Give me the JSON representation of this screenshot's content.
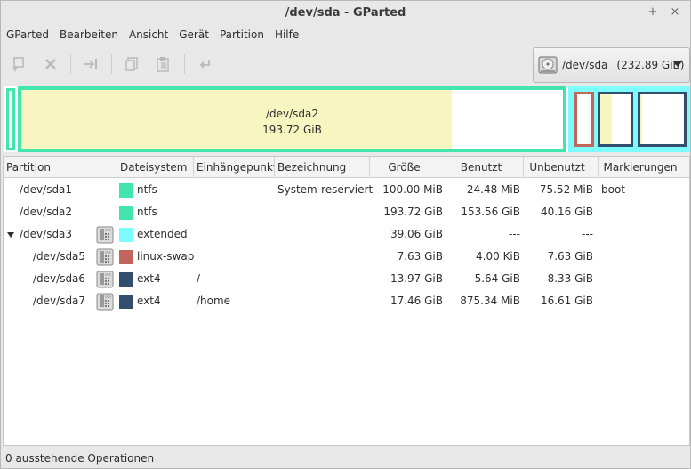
{
  "window": {
    "title": "/dev/sda - GParted",
    "minimize": "–",
    "maximize": "+",
    "close": "×"
  },
  "menu": [
    "GParted",
    "Bearbeiten",
    "Ansicht",
    "Gerät",
    "Partition",
    "Hilfe"
  ],
  "toolbar": {
    "icons": [
      "new-partition-icon",
      "delete-icon",
      "resize-move-icon",
      "copy-icon",
      "paste-icon",
      "undo-icon"
    ]
  },
  "device": {
    "name": "/dev/sda",
    "size": "(232.89 GiB)"
  },
  "diskmap": {
    "selected_label": "/dev/sda2",
    "selected_size": "193.72 GiB",
    "colors": {
      "ntfs": "#42e5ac",
      "extended": "#7dfcfe",
      "linux_swap": "#c1665a",
      "ext4": "#314e6c",
      "used": "#f7f6c0"
    }
  },
  "columns": [
    "Partition",
    "Dateisystem",
    "Einhängepunkt",
    "Bezeichnung",
    "Größe",
    "Benutzt",
    "Unbenutzt",
    "Markierungen"
  ],
  "rows": [
    {
      "partition": "/dev/sda1",
      "filesystem": "ntfs",
      "color": "#42e5ac",
      "mount": "",
      "label": "System-reserviert",
      "size": "100.00 MiB",
      "used": "24.48 MiB",
      "unused": "75.52 MiB",
      "flags": "boot",
      "locked": false,
      "level": 0
    },
    {
      "partition": "/dev/sda2",
      "filesystem": "ntfs",
      "color": "#42e5ac",
      "mount": "",
      "label": "",
      "size": "193.72 GiB",
      "used": "153.56 GiB",
      "unused": "40.16 GiB",
      "flags": "",
      "locked": false,
      "level": 0
    },
    {
      "partition": "/dev/sda3",
      "filesystem": "extended",
      "color": "#7dfcfe",
      "mount": "",
      "label": "",
      "size": "39.06 GiB",
      "used": "---",
      "unused": "---",
      "flags": "",
      "locked": true,
      "level": 0,
      "expanded": true
    },
    {
      "partition": "/dev/sda5",
      "filesystem": "linux-swap",
      "color": "#c1665a",
      "mount": "",
      "label": "",
      "size": "7.63 GiB",
      "used": "4.00 KiB",
      "unused": "7.63 GiB",
      "flags": "",
      "locked": true,
      "level": 1
    },
    {
      "partition": "/dev/sda6",
      "filesystem": "ext4",
      "color": "#314e6c",
      "mount": "/",
      "label": "",
      "size": "13.97 GiB",
      "used": "5.64 GiB",
      "unused": "8.33 GiB",
      "flags": "",
      "locked": true,
      "level": 1
    },
    {
      "partition": "/dev/sda7",
      "filesystem": "ext4",
      "color": "#314e6c",
      "mount": "/home",
      "label": "",
      "size": "17.46 GiB",
      "used": "875.34 MiB",
      "unused": "16.61 GiB",
      "flags": "",
      "locked": true,
      "level": 1
    }
  ],
  "status": "0 ausstehende Operationen"
}
